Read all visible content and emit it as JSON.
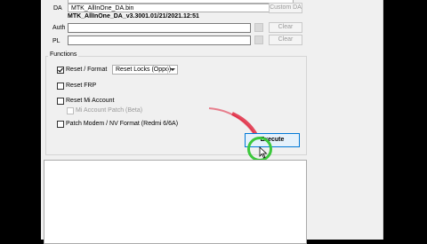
{
  "da": {
    "label": "DA",
    "file_value": "MTK_AllInOne_DA.bin",
    "custom_button": "Custom DA",
    "info": "MTK_AllInOne_DA_v3.3001.01/21/2021.12:51"
  },
  "auth": {
    "label": "Auth",
    "clear_button": "Clear"
  },
  "pl": {
    "label": "PL",
    "clear_button": "Clear"
  },
  "functions": {
    "title": "Functions",
    "reset_format": {
      "label": "Reset / Format",
      "checked": true
    },
    "reset_mode_select": "Reset Locks (Oppo)",
    "reset_frp": {
      "label": "Reset FRP",
      "checked": false
    },
    "reset_mi_account": {
      "label": "Reset Mi Account",
      "checked": false
    },
    "mi_account_patch": {
      "label": "Mi Account Patch (Beta)",
      "checked": false
    },
    "patch_modem": {
      "label": "Patch Modem / NV Format (Redmi 6/6A)",
      "checked": false
    },
    "execute_button": "Execute"
  },
  "colors": {
    "accent": "#0078d7",
    "highlight_circle": "#3cc83c",
    "cursor_trail": "#e0203a"
  }
}
